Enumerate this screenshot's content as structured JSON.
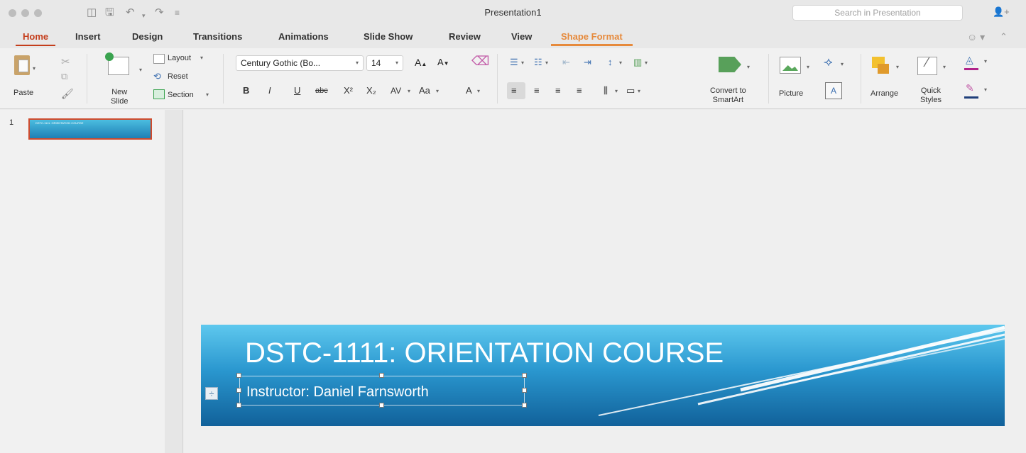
{
  "window": {
    "title": "Presentation1",
    "search_placeholder": "Search in Presentation"
  },
  "tabs": [
    {
      "label": "Home",
      "active": true
    },
    {
      "label": "Insert"
    },
    {
      "label": "Design"
    },
    {
      "label": "Transitions"
    },
    {
      "label": "Animations"
    },
    {
      "label": "Slide Show"
    },
    {
      "label": "Review"
    },
    {
      "label": "View"
    },
    {
      "label": "Shape Format",
      "contextual": true
    }
  ],
  "ribbon": {
    "paste": "Paste",
    "new_slide": "New\nSlide",
    "layout": "Layout",
    "reset": "Reset",
    "section": "Section",
    "font_name": "Century Gothic (Bo...",
    "font_size": "14",
    "grow_font": "A",
    "shrink_font": "A",
    "bold": "B",
    "italic": "I",
    "underline": "U",
    "strikethrough": "abc",
    "superscript": "X²",
    "subscript": "X₂",
    "char_spacing": "AV",
    "change_case": "Aa",
    "font_color": "A",
    "convert_smartart": "Convert to\nSmartArt",
    "picture": "Picture",
    "arrange": "Arrange",
    "quick_styles": "Quick\nStyles"
  },
  "thumbnails": [
    {
      "number": "1",
      "text": "DSTC-1111: ORIENTATION COURSE"
    }
  ],
  "slide": {
    "title": "DSTC-1111: ORIENTATION COURSE",
    "subtitle": "Instructor: Daniel Farnsworth"
  },
  "colors": {
    "accent": "#c43e1c",
    "contextual": "#e68a3c",
    "slide_top": "#5ec8ee",
    "slide_bottom": "#11619a"
  }
}
